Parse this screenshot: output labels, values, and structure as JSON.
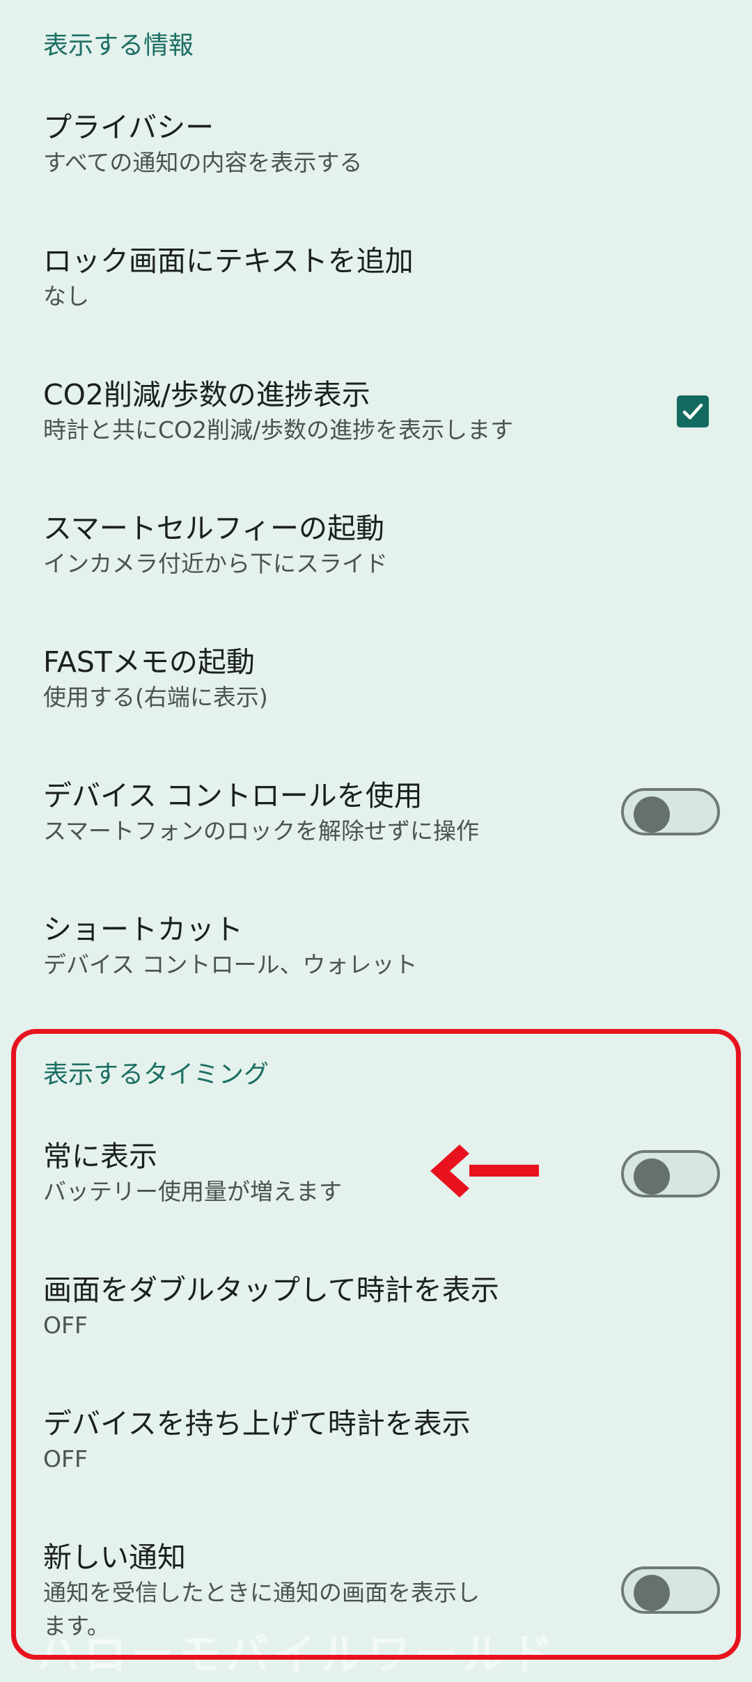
{
  "sections": {
    "display_info": "表示する情報",
    "display_timing": "表示するタイミング"
  },
  "items": {
    "privacy": {
      "title": "プライバシー",
      "summary": "すべての通知の内容を表示する"
    },
    "lock_text": {
      "title": "ロック画面にテキストを追加",
      "summary": "なし"
    },
    "co2": {
      "title": "CO2削減/歩数の進捗表示",
      "summary": "時計と共にCO2削減/歩数の進捗を表示します",
      "checked": true
    },
    "smart_selfie": {
      "title": "スマートセルフィーの起動",
      "summary": "インカメラ付近から下にスライド"
    },
    "fast_memo": {
      "title": "FASTメモの起動",
      "summary": "使用する(右端に表示)"
    },
    "device_controls": {
      "title": "デバイス コントロールを使用",
      "summary": "スマートフォンのロックを解除せずに操作",
      "enabled": false
    },
    "shortcuts": {
      "title": "ショートカット",
      "summary": "デバイス コントロール、ウォレット"
    },
    "always_on": {
      "title": "常に表示",
      "summary": "バッテリー使用量が増えます",
      "enabled": false
    },
    "double_tap": {
      "title": "画面をダブルタップして時計を表示",
      "summary": "OFF"
    },
    "lift_to_show": {
      "title": "デバイスを持ち上げて時計を表示",
      "summary": "OFF"
    },
    "new_notification": {
      "title": "新しい通知",
      "summary": "通知を受信したときに通知の画面を表示します。",
      "enabled": false
    }
  },
  "annotation": {
    "highlight_color": "#e8121e",
    "arrow_icon": "left-arrow"
  },
  "watermark": "ハローモバイルワールド",
  "colors": {
    "background": "#e4f1ec",
    "accent": "#136b5f",
    "section_header": "#1a6e63"
  }
}
